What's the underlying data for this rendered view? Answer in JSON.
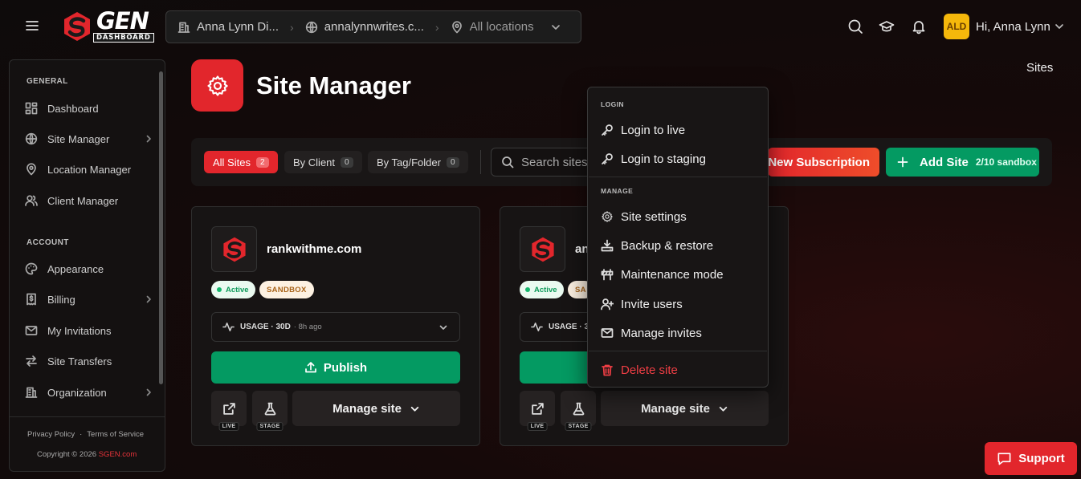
{
  "topbar": {
    "logo_text": "GEN",
    "logo_sub": "DASHBOARD",
    "breadcrumb": {
      "client": "Anna Lynn Di...",
      "site": "annalynnwrites.c...",
      "location": "All locations"
    },
    "avatar_initials": "ALD",
    "greeting": "Hi, Anna Lynn",
    "icons": [
      "menu-icon",
      "search-icon",
      "graduation-cap-icon",
      "bell-icon",
      "chevron-down-icon"
    ]
  },
  "sidebar": {
    "general_label": "GENERAL",
    "general_items": [
      {
        "label": "Dashboard",
        "icon": "grid-icon"
      },
      {
        "label": "Site Manager",
        "icon": "globe-icon",
        "has_chevron": true
      },
      {
        "label": "Location Manager",
        "icon": "map-pin-icon"
      },
      {
        "label": "Client Manager",
        "icon": "users-icon"
      }
    ],
    "account_label": "ACCOUNT",
    "account_items": [
      {
        "label": "Appearance",
        "icon": "palette-icon"
      },
      {
        "label": "Billing",
        "icon": "receipt-icon",
        "has_chevron": true
      },
      {
        "label": "My Invitations",
        "icon": "mail-icon"
      },
      {
        "label": "Site Transfers",
        "icon": "transfer-icon"
      },
      {
        "label": "Organization",
        "icon": "building-icon",
        "has_chevron": true
      }
    ],
    "footer": {
      "privacy": "Privacy Policy",
      "separator": "·",
      "terms": "Terms of Service",
      "copyright": "Copyright © 2026",
      "brand": "SGEN.com"
    }
  },
  "page": {
    "title": "Site Manager",
    "breadcrumb_right": "Sites"
  },
  "filters": {
    "tabs": [
      {
        "label": "All Sites",
        "count": "2",
        "active": true
      },
      {
        "label": "By Client",
        "count": "0",
        "active": false
      },
      {
        "label": "By Tag/Folder",
        "count": "0",
        "active": false
      }
    ],
    "search_placeholder": "Search sites",
    "new_subscription": "New Subscription",
    "add_site": "Add Site",
    "add_site_note": "2/10 sandbox"
  },
  "sites": [
    {
      "name": "rankwithme.com",
      "status": "Active",
      "plan": "SANDBOX",
      "usage_label": "USAGE · 30D",
      "usage_ago": "· 8h ago",
      "publish": "Publish",
      "live_tag": "LIVE",
      "stage_tag": "STAGE",
      "manage": "Manage site"
    },
    {
      "name": "an",
      "status": "Active",
      "plan": "SA",
      "usage_label": "USAGE · 3",
      "publish": "",
      "live_tag": "LIVE",
      "stage_tag": "STAGE",
      "manage": "Manage site"
    }
  ],
  "menu": {
    "login_section": "LOGIN",
    "login_items": [
      {
        "label": "Login to live",
        "icon": "key-icon"
      },
      {
        "label": "Login to staging",
        "icon": "key-icon"
      }
    ],
    "manage_section": "MANAGE",
    "manage_items": [
      {
        "label": "Site settings",
        "icon": "gear-icon"
      },
      {
        "label": "Backup & restore",
        "icon": "download-tray-icon"
      },
      {
        "label": "Maintenance mode",
        "icon": "barrier-icon"
      },
      {
        "label": "Invite users",
        "icon": "user-plus-icon"
      },
      {
        "label": "Manage invites",
        "icon": "envelope-icon"
      }
    ],
    "delete": "Delete site"
  },
  "support": "Support",
  "colors": {
    "brand_red": "#e2262c",
    "accent_green": "#049a62",
    "avatar_yellow": "#f5b80b",
    "danger": "#ef3e44"
  }
}
